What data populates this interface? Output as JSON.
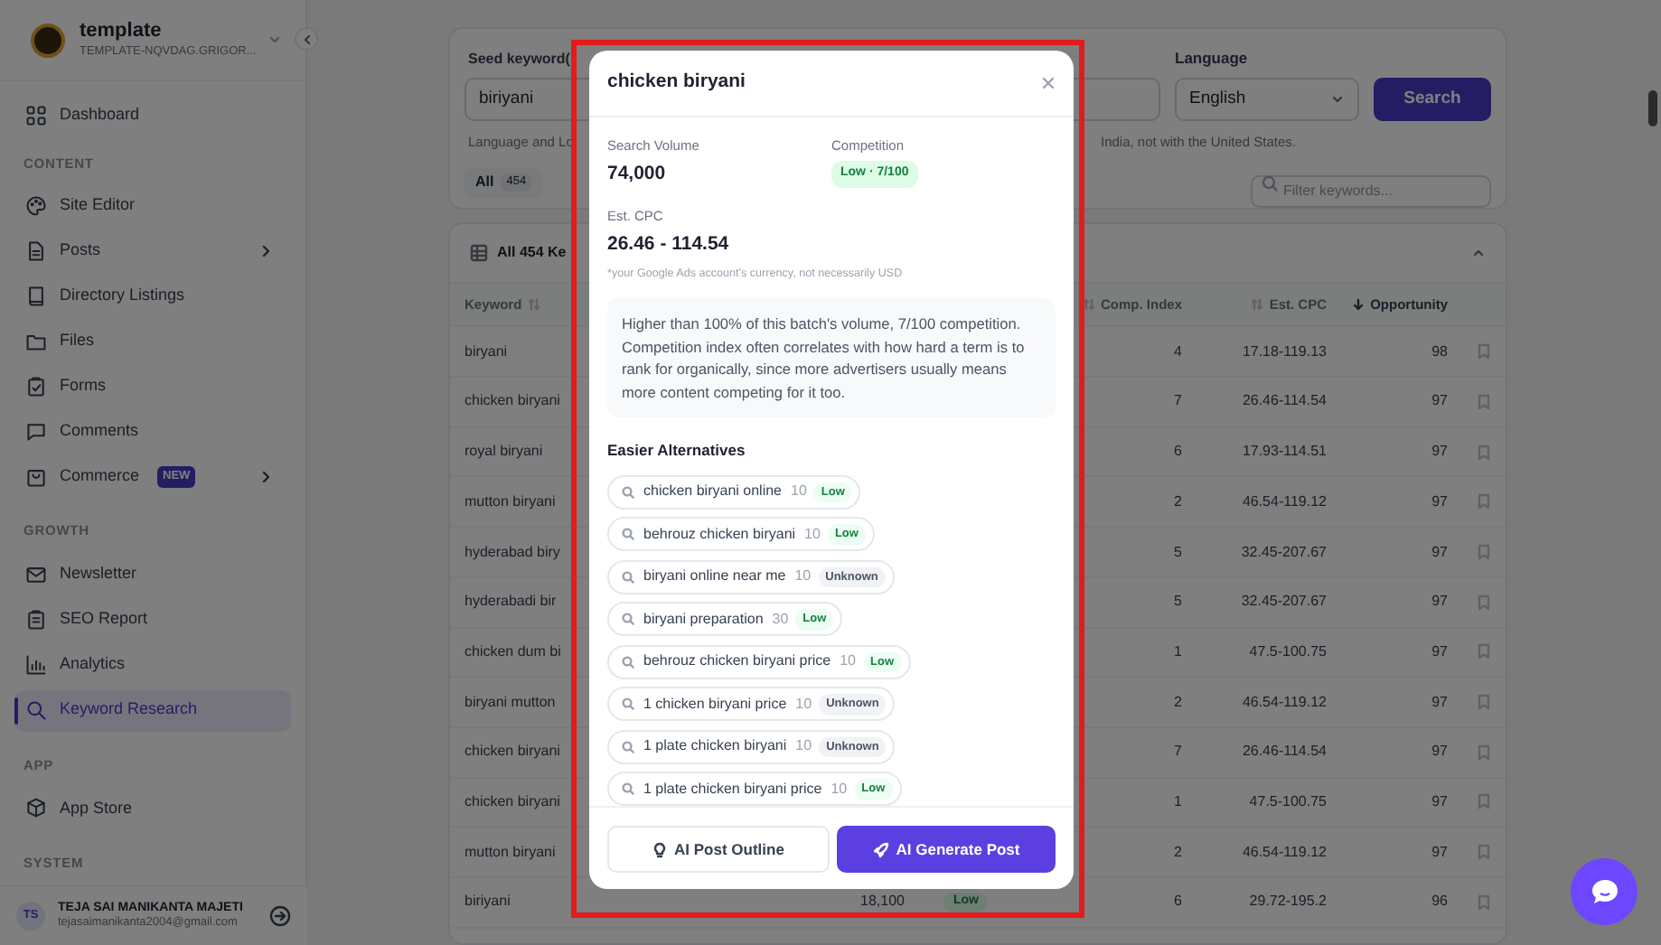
{
  "sidebar": {
    "site": {
      "name": "template",
      "domain": "TEMPLATE-NQVDAG.GRIGOR..."
    },
    "sections": [
      {
        "items": [
          {
            "label": "Dashboard",
            "selected": false,
            "has_submenu": false
          }
        ]
      },
      {
        "title": "CONTENT",
        "items": [
          {
            "label": "Site Editor",
            "selected": false,
            "has_submenu": false
          },
          {
            "label": "Posts",
            "selected": false,
            "has_submenu": true
          },
          {
            "label": "Directory Listings",
            "selected": false,
            "has_submenu": false
          },
          {
            "label": "Files",
            "selected": false,
            "has_submenu": false
          },
          {
            "label": "Forms",
            "selected": false,
            "has_submenu": false
          },
          {
            "label": "Comments",
            "selected": false,
            "has_submenu": false
          },
          {
            "label": "Commerce",
            "badge": "NEW",
            "selected": false,
            "has_submenu": true
          }
        ]
      },
      {
        "title": "GROWTH",
        "items": [
          {
            "label": "Newsletter",
            "selected": false,
            "has_submenu": false
          },
          {
            "label": "SEO Report",
            "selected": false,
            "has_submenu": false
          },
          {
            "label": "Analytics",
            "selected": false,
            "has_submenu": false
          },
          {
            "label": "Keyword Research",
            "selected": true,
            "has_submenu": false
          }
        ]
      },
      {
        "title": "APP",
        "items": [
          {
            "label": "App Store",
            "selected": false,
            "has_submenu": false
          }
        ]
      },
      {
        "title": "SYSTEM"
      }
    ],
    "user": {
      "initials": "TS",
      "name": "TEJA SAI MANIKANTA MAJETI",
      "email": "tejasaimanikanta2004@gmail.com"
    }
  },
  "search_form": {
    "seed_label": "Seed keyword(",
    "seed_value": "biriyani",
    "language_label": "Language",
    "language_value": "English",
    "search_button": "Search",
    "hint_start": "Language and Lo",
    "hint_end": "India, not with the United States."
  },
  "filter_tabs": [
    {
      "label": "All",
      "count": "454",
      "selected": true
    }
  ],
  "filter": {
    "placeholder": "Filter keywords..."
  },
  "table": {
    "title": "All 454 Ke",
    "columns": [
      {
        "label": "Keyword",
        "sorted": false
      },
      {
        "label": "Comp. Index",
        "sorted": false
      },
      {
        "label": "Est. CPC",
        "sorted": false
      },
      {
        "label": "Opportunity",
        "sorted": true
      }
    ],
    "rows": [
      {
        "keyword": "biryani",
        "comp_index": "4",
        "cpc": "17.18-119.13",
        "opportunity": "98"
      },
      {
        "keyword": "chicken biryani",
        "comp_index": "7",
        "cpc": "26.46-114.54",
        "opportunity": "97"
      },
      {
        "keyword": "royal biryani",
        "comp_index": "6",
        "cpc": "17.93-114.51",
        "opportunity": "97"
      },
      {
        "keyword": "mutton biryani",
        "comp_index": "2",
        "cpc": "46.54-119.12",
        "opportunity": "97"
      },
      {
        "keyword": "hyderabad biry",
        "comp_index": "5",
        "cpc": "32.45-207.67",
        "opportunity": "97"
      },
      {
        "keyword": "hyderabadi bir",
        "comp_index": "5",
        "cpc": "32.45-207.67",
        "opportunity": "97"
      },
      {
        "keyword": "chicken dum bi",
        "comp_index": "1",
        "cpc": "47.5-100.75",
        "opportunity": "97"
      },
      {
        "keyword": "biryani mutton",
        "comp_index": "2",
        "cpc": "46.54-119.12",
        "opportunity": "97"
      },
      {
        "keyword": "chicken biryani",
        "comp_index": "7",
        "cpc": "26.46-114.54",
        "opportunity": "97"
      },
      {
        "keyword": "chicken biryani",
        "comp_index": "1",
        "cpc": "47.5-100.75",
        "opportunity": "97"
      },
      {
        "keyword": "mutton biryani",
        "comp_index": "2",
        "cpc": "46.54-119.12",
        "opportunity": "97"
      },
      {
        "keyword": "biriyani",
        "volume": "18,100",
        "competition": "Low",
        "comp_index": "6",
        "cpc": "29.72-195.2",
        "opportunity": "96"
      }
    ]
  },
  "modal": {
    "title": "chicken biryani",
    "search_volume": {
      "label": "Search Volume",
      "value": "74,000"
    },
    "competition": {
      "label": "Competition",
      "badge": "Low · 7/100"
    },
    "cpc": {
      "label": "Est. CPC",
      "value": "26.46 - 114.54",
      "note": "*your Google Ads account's currency, not necessarily USD"
    },
    "summary": "Higher than 100% of this batch's volume, 7/100 competition. Competition index often correlates with how hard a term is to rank for organically, since more advertisers usually means more content competing for it too.",
    "alternatives_title": "Easier Alternatives",
    "alternatives": [
      {
        "keyword": "chicken biryani online",
        "volume": "10",
        "level": "Low",
        "kind": "low"
      },
      {
        "keyword": "behrouz chicken biryani",
        "volume": "10",
        "level": "Low",
        "kind": "low"
      },
      {
        "keyword": "biryani online near me",
        "volume": "10",
        "level": "Unknown",
        "kind": "unknown"
      },
      {
        "keyword": "biryani preparation",
        "volume": "30",
        "level": "Low",
        "kind": "low"
      },
      {
        "keyword": "behrouz chicken biryani price",
        "volume": "10",
        "level": "Low",
        "kind": "low"
      },
      {
        "keyword": "1 chicken biryani price",
        "volume": "10",
        "level": "Unknown",
        "kind": "unknown"
      },
      {
        "keyword": "1 plate chicken biryani",
        "volume": "10",
        "level": "Unknown",
        "kind": "unknown"
      },
      {
        "keyword": "1 plate chicken biryani price",
        "volume": "10",
        "level": "Low",
        "kind": "low"
      }
    ],
    "buttons": [
      {
        "label": "AI Post Outline",
        "kind": "secondary"
      },
      {
        "label": "AI Generate Post",
        "kind": "primary"
      }
    ]
  }
}
